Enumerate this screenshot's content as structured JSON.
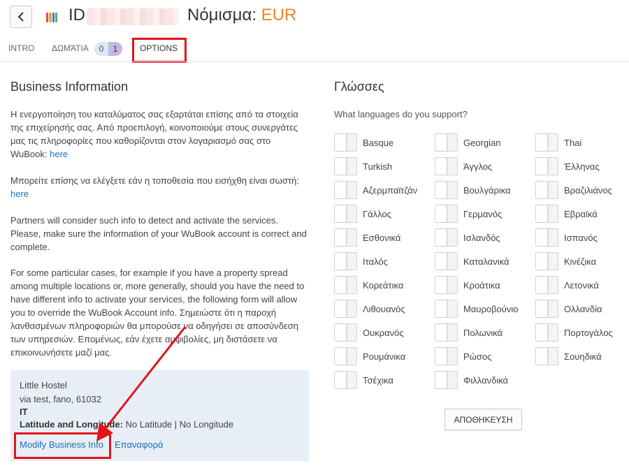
{
  "header": {
    "id_label": "ID",
    "currency_label": "Νόμισμα:",
    "currency_value": "EUR",
    "back_icon": "chevron-left-icon",
    "logo_colors": [
      "#e94b3c",
      "#f2a33a",
      "#3a7bd5",
      "#55b05a"
    ]
  },
  "tabs": {
    "intro": "INTRO",
    "rooms": "ΔΩΜΆΤΙΑ",
    "rooms_count_a": "0",
    "rooms_count_b": "1",
    "options": "OPTIONS"
  },
  "business": {
    "title": "Business Information",
    "p1_text": "Η ενεργοποίηση του καταλύματος σας εξαρτάται επίσης από τα στοιχεία της επιχείρησής σας. Από προεπιλογή, κοινοποιούμε στους συνεργάτες μας τις πληροφορίες που καθορίζονται στον λογαριασμό σας στο WuBook: ",
    "p1_link": "here",
    "p2_text": "Μπορείτε επίσης να ελέγξετε εάν η τοποθεσία που εισήχθη είναι σωστή: ",
    "p2_link": "here",
    "p3_text": "Partners will consider such info to detect and activate the services. Please, make sure the information of your WuBook account is correct and complete.",
    "p4_text": "For some particular cases, for example if you have a property spread among multiple locations or, more generally, should you have the need to have different info to activate your services, the following form will allow you to override the WuBook Account info. Σημειώστε ότι η παροχή λανθασμένων πληροφοριών θα μπορούσε να οδηγήσει σε αποσύνδεση των υπηρεσιών. Επομένως, εάν έχετε αμφιβολίες, μη διστάσετε να επικοινωνήσετε μαζί μας.",
    "box": {
      "name": "Little Hostel",
      "address": "via test, fano, 61032",
      "country": "IT",
      "latlng_label": "Latitude and Longitude:",
      "latlng_value": "No Latitude | No Longitude",
      "modify_link": "Modify Business Info",
      "reset_link": "Επαναφορά"
    }
  },
  "languages": {
    "title": "Γλώσσες",
    "question": "What languages do you support?",
    "items": [
      "Basque",
      "Georgian",
      "Thai",
      "Turkish",
      "Άγγλος",
      "Έλληνας",
      "Αζερμπαϊτζάν",
      "Βουλγάρικα",
      "Βραζιλιάνος",
      "Γάλλος",
      "Γερμανός",
      "Εβραϊκά",
      "Εσθονικά",
      "Ισλανδός",
      "Ισπανός",
      "Ιταλός",
      "Καταλανικά",
      "Κινέζικα",
      "Κορεάτικα",
      "Κροάτικα",
      "Λετονικά",
      "Λιθουανός",
      "Μαυροβούνιο",
      "Ολλανδία",
      "Ουκρανός",
      "Πολωνικά",
      "Πορτογάλος",
      "Ρουμάνικα",
      "Ρώσος",
      "Σουηδικά",
      "Τσέχικα",
      "Φιλλανδικά"
    ],
    "save_label": "ΑΠΟΘΗΚΕΥΣΗ"
  }
}
